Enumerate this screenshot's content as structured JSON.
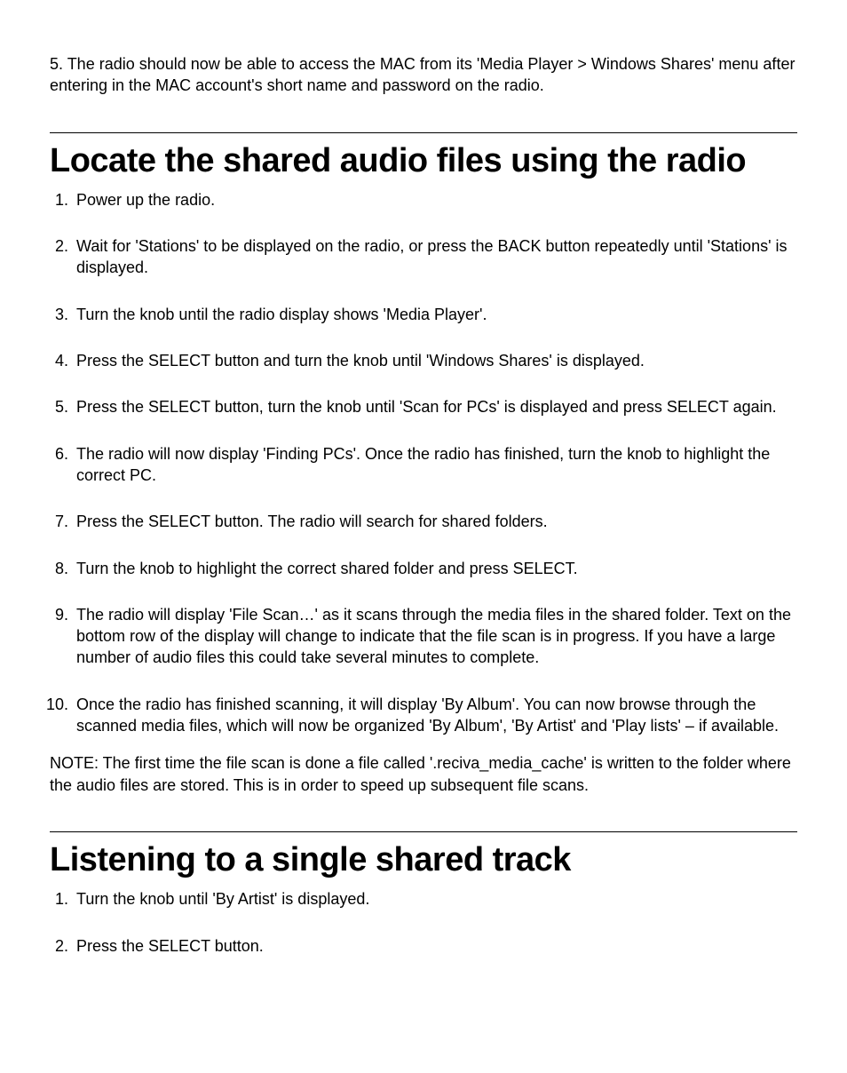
{
  "intro": "5. The radio should now be able to access the MAC from its 'Media Player > Windows Shares' menu after entering in the MAC account's short name and password on the radio.",
  "section1": {
    "heading": "Locate the shared audio files using the radio",
    "items": [
      "Power up the radio.",
      "Wait for 'Stations' to be displayed on the radio, or press the BACK button repeatedly until 'Stations' is displayed.",
      "Turn the knob until the radio display shows 'Media Player'.",
      "Press the SELECT button and turn the knob until  'Windows Shares' is displayed.",
      "Press the SELECT button, turn the knob until 'Scan for PCs' is displayed and press SELECT again.",
      "The radio will now display 'Finding PCs'. Once the radio has finished, turn the knob to highlight the correct PC.",
      "Press the SELECT button. The radio will search for shared folders.",
      "Turn the knob to highlight the correct shared folder and press SELECT.",
      "The radio will display 'File Scan…' as it scans through the media files in the shared folder. Text on the bottom row of the display will change to indicate that the file scan is in progress. If you have a large number of audio files this could take several minutes to complete.",
      "Once the radio has finished scanning, it will display 'By Album'. You can now browse through the scanned media files, which will now be organized 'By Album', 'By Artist' and 'Play lists' – if available."
    ],
    "note": "NOTE: The first time the file scan is done a file called '.reciva_media_cache' is written to the folder where the audio files are stored. This is in order to speed up subsequent file scans."
  },
  "section2": {
    "heading": "Listening to a single shared track",
    "items": [
      "Turn the knob until 'By Artist' is displayed.",
      "Press the SELECT button."
    ]
  }
}
